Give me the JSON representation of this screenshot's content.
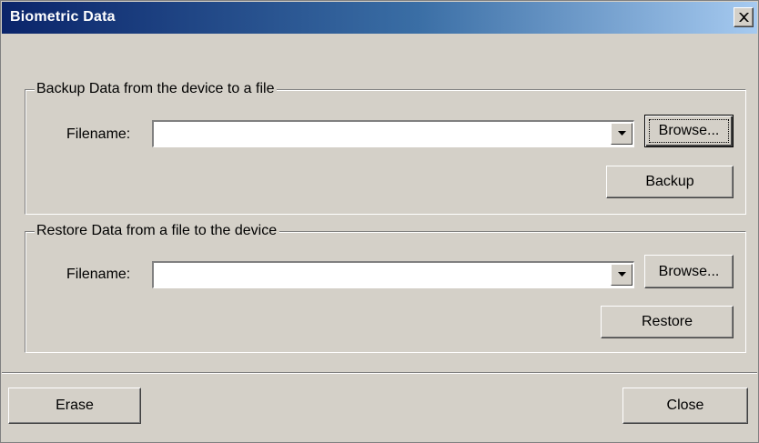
{
  "window": {
    "title": "Biometric Data"
  },
  "backup": {
    "group_label": "Backup Data from the device to a file",
    "filename_label": "Filename:",
    "filename_value": "",
    "browse_label": "Browse...",
    "action_label": "Backup"
  },
  "restore": {
    "group_label": "Restore Data from a file to the device",
    "filename_label": "Filename:",
    "filename_value": "",
    "browse_label": "Browse...",
    "action_label": "Restore"
  },
  "footer": {
    "erase_label": "Erase",
    "close_label": "Close"
  },
  "icons": {
    "close": "close-icon",
    "dropdown": "chevron-down-icon"
  },
  "colors": {
    "title_gradient_start": "#0a246a",
    "title_gradient_end": "#a6caf0",
    "face": "#d4d0c8"
  }
}
